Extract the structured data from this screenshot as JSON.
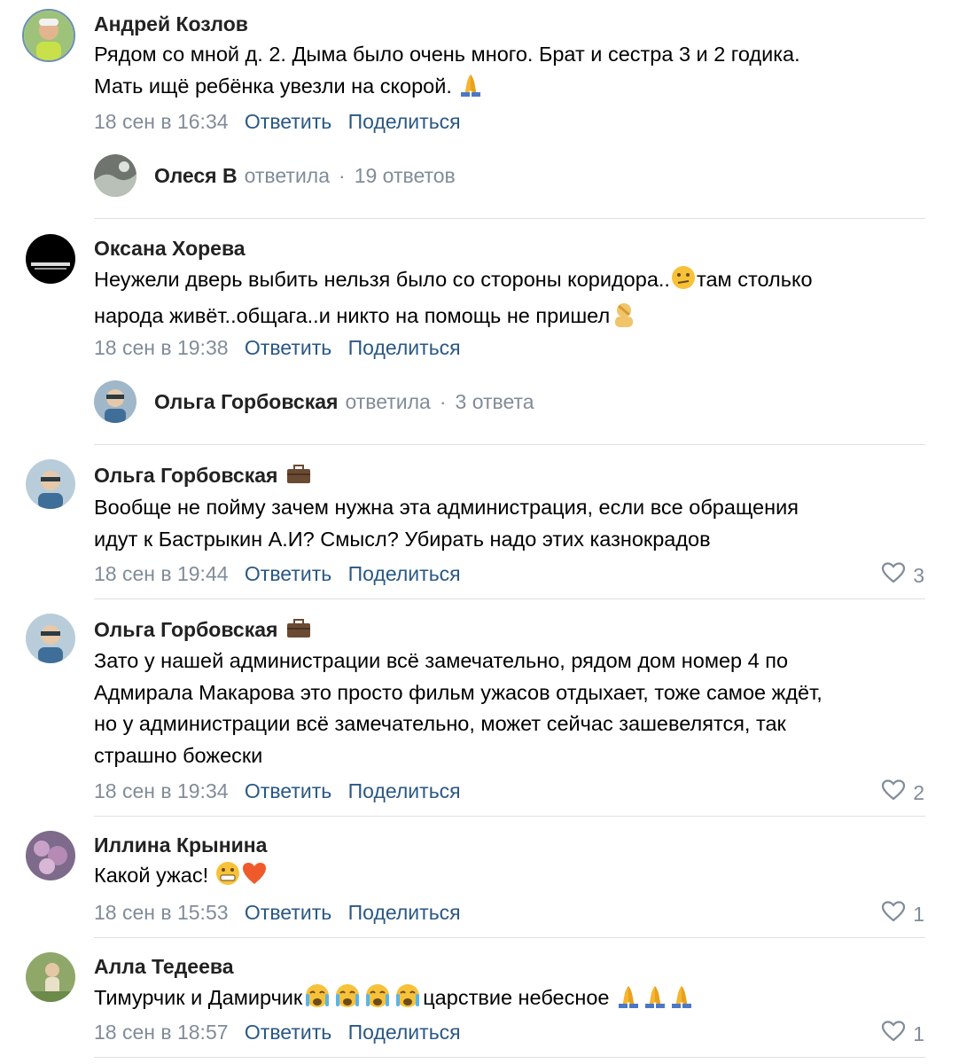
{
  "comments": [
    {
      "author": "Андрей Козлов",
      "text_1": "Рядом со мной д. 2. Дыма было очень много. Брат и сестра 3 и 2 годика.",
      "text_2": "Мать ищё ребёнка увезли на скорой.",
      "emoji": "praying-hands",
      "date": "18 сен в 16:34",
      "reply_label": "Ответить",
      "share_label": "Поделиться",
      "thread": {
        "author": "Олеся В",
        "verb": "ответила",
        "dot": "·",
        "count": "19 ответов"
      }
    },
    {
      "author": "Оксана Хорева",
      "text_1a": "Неужели дверь выбить нельзя было со стороны коридора..",
      "text_1b": "там столько",
      "text_2": "народа живёт..общага..и никто на помощь не пришел",
      "date": "18 сен в 19:38",
      "reply_label": "Ответить",
      "share_label": "Поделиться",
      "thread": {
        "author": "Ольга Горбовская",
        "verb": "ответила",
        "dot": "·",
        "count": "3 ответа"
      }
    },
    {
      "author": "Ольга Горбовская",
      "text": "Вообще не пойму зачем нужна эта администрация, если все обращения\nидут к Бастрыкин А.И? Смысл? Убирать надо этих казнокрадов",
      "date": "18 сен в 19:44",
      "reply_label": "Ответить",
      "share_label": "Поделиться",
      "likes": "3"
    },
    {
      "author": "Ольга Горбовская",
      "text": "Зато у нашей администрации всё замечательно, рядом дом номер 4 по\nАдмирала Макарова это просто фильм ужасов отдыхает, тоже самое ждёт,\nно у администрации всё замечательно, может сейчас зашевелятся, так\nстрашно божески",
      "date": "18 сен в 19:34",
      "reply_label": "Ответить",
      "share_label": "Поделиться",
      "likes": "2"
    },
    {
      "author": "Иллина Крынина",
      "text": "Какой ужас!",
      "date": "18 сен в 15:53",
      "reply_label": "Ответить",
      "share_label": "Поделиться",
      "likes": "1"
    },
    {
      "author": "Алла Тедеева",
      "text_a": "Тимурчик и Дамирчик",
      "text_b": "царствие небесное",
      "date": "18 сен в 18:57",
      "reply_label": "Ответить",
      "share_label": "Поделиться",
      "likes": "1"
    }
  ],
  "colors": {
    "link": "#2a5885",
    "meta": "#818c99",
    "divider": "#dce1e6"
  }
}
